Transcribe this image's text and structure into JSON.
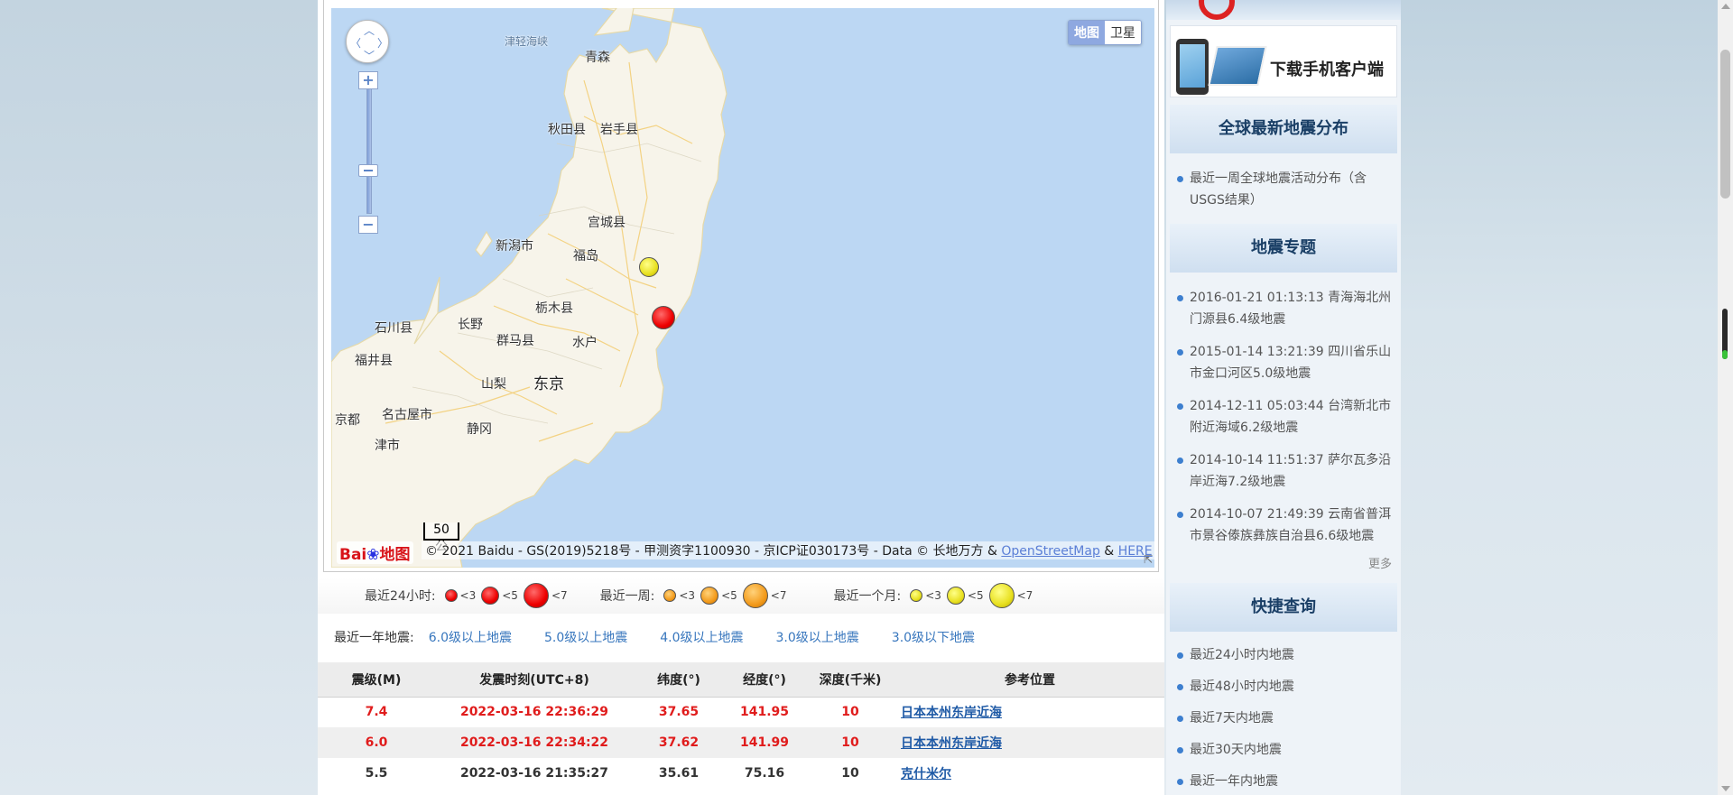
{
  "map": {
    "type_buttons": {
      "map": "地图",
      "satellite": "卫星"
    },
    "places": {
      "strait": "津轻海峡",
      "aomori": "青森",
      "akita": "秋田县",
      "iwate": "岩手县",
      "miyagi": "宫城县",
      "niigata": "新潟市",
      "fukushima": "福岛",
      "tochigi": "栃木县",
      "ishikawa": "石川县",
      "nagano": "长野",
      "gunma": "群马县",
      "mito": "水户",
      "fukui": "福井县",
      "yamanashi": "山梨",
      "tokyo": "东京",
      "kyoto": "京都",
      "nagoya": "名古屋市",
      "shizuoka": "静冈",
      "tsu": "津市"
    },
    "scale_label": "50 公",
    "logo_text": "Bai",
    "logo_suffix": "地图",
    "copyright": "© 2021 Baidu - GS(2019)5218号 - 甲测资字1100930 - 京ICP证030173号 - Data © 长地万方 & ",
    "osm_link": "OpenStreetMap",
    "amp": " & ",
    "here_link": "HERE",
    "markers": [
      {
        "color": "#e8e020",
        "label": "yellow",
        "magnitude_class": "<5",
        "period": "最近一个月"
      },
      {
        "color": "#e00000",
        "label": "red",
        "magnitude_class": "<7",
        "period": "最近24小时"
      }
    ]
  },
  "legend": {
    "day": {
      "label": "最近24小时:",
      "items": [
        "<3",
        "<5",
        "<7"
      ]
    },
    "week": {
      "label": "最近一周:",
      "items": [
        "<3",
        "<5",
        "<7"
      ]
    },
    "month": {
      "label": "最近一个月:",
      "items": [
        "<3",
        "<5",
        "<7"
      ]
    }
  },
  "year_links": {
    "label": "最近一年地震:",
    "links": [
      "6.0级以上地震",
      "5.0级以上地震",
      "4.0级以上地震",
      "3.0级以上地震",
      "3.0级以下地震"
    ]
  },
  "table": {
    "headers": [
      "震级(M)",
      "发震时刻(UTC+8)",
      "纬度(°)",
      "经度(°)",
      "深度(千米)",
      "参考位置"
    ],
    "rows": [
      [
        "7.4",
        "2022-03-16 22:36:29",
        "37.65",
        "141.95",
        "10",
        "日本本州东岸近海"
      ],
      [
        "6.0",
        "2022-03-16 22:34:22",
        "37.62",
        "141.99",
        "10",
        "日本本州东岸近海"
      ],
      [
        "5.5",
        "2022-03-16 21:35:27",
        "35.61",
        "75.16",
        "10",
        "克什米尔"
      ]
    ]
  },
  "sidebar": {
    "app_download": "下载手机客户端",
    "global_title": "全球最新地震分布",
    "global_items": [
      "最近一周全球地震活动分布（含USGS结果）"
    ],
    "topics_title": "地震专题",
    "topics": [
      "2016-01-21 01:13:13 青海海北州门源县6.4级地震",
      "2015-01-14 13:21:39 四川省乐山市金口河区5.0级地震",
      "2014-12-11 05:03:44 台湾新北市附近海域6.2级地震",
      "2014-10-14 11:51:37 萨尔瓦多沿岸近海7.2级地震",
      "2014-10-07 21:49:39 云南省普洱市景谷傣族彝族自治县6.6级地震"
    ],
    "more": "更多",
    "quick_title": "快捷查询",
    "quick_items": [
      "最近24小时内地震",
      "最近48小时内地震",
      "最近7天内地震",
      "最近30天内地震",
      "最近一年内地震"
    ]
  },
  "colors": {
    "link": "#3776bd",
    "hot_row": "#e01c1c",
    "map_water": "#bcd7f3",
    "land": "#f7f4ea"
  }
}
